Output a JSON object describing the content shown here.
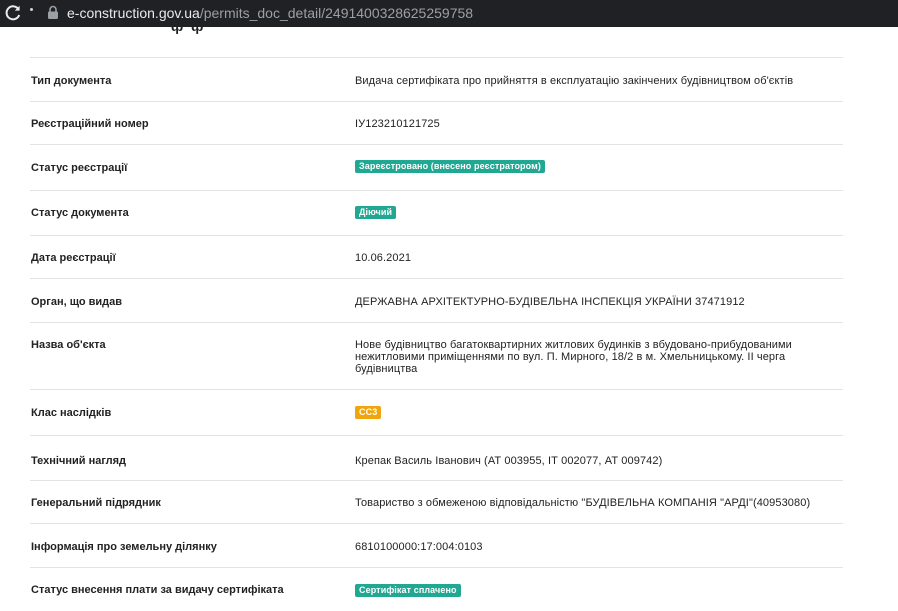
{
  "browser": {
    "url_domain": "e-construction.gov.ua",
    "url_path": "/permits_doc_detail/2491400328625259758"
  },
  "header": {
    "cut_title": "ф ф"
  },
  "rows": [
    {
      "label": "Тип документа",
      "value": "Видача сертифіката про прийняття в експлуатацію закінчених будівництвом об'єктів"
    },
    {
      "label": "Реєстраційний номер",
      "value": "ІУ123210121725"
    },
    {
      "label": "Статус реєстрації",
      "badge": "Зареєстровано (внесено реєстратором)",
      "badge_color": "#21a892"
    },
    {
      "label": "Статус документа",
      "badge": "Діючий",
      "badge_color": "#21a892"
    },
    {
      "label": "Дата реєстрації",
      "value": "10.06.2021"
    },
    {
      "label": "Орган, що видав",
      "value": "ДЕРЖАВНА АРХІТЕКТУРНО-БУДІВЕЛЬНА ІНСПЕКЦІЯ УКРАЇНИ 37471912"
    },
    {
      "label": "Назва об'єкта",
      "value": "Нове будівництво багатоквартирних житлових будинків з вбудовано-прибудованими нежитловими приміщеннями по вул. П. Мирного, 18/2 в м. Хмельницькому. ІІ черга будівництва"
    },
    {
      "label": "Клас наслідків",
      "badge": "СС3",
      "badge_color": "#f0a50c"
    },
    {
      "label": "Технічний нагляд",
      "value": "Крепак Василь Іванович (АТ 003955, ІТ 002077, АТ 009742)"
    },
    {
      "label": "Генеральний підрядник",
      "value": "Товариство з обмеженою відповідальністю \"БУДІВЕЛЬНА КОМПАНІЯ \"АРДІ\"(40953080)"
    },
    {
      "label": "Інформація про земельну ділянку",
      "value": "6810100000:17:004:0103"
    },
    {
      "label": "Статус внесення плати за видачу сертифіката",
      "badge": "Сертифікат сплачено",
      "badge_color": "#21a892"
    }
  ]
}
